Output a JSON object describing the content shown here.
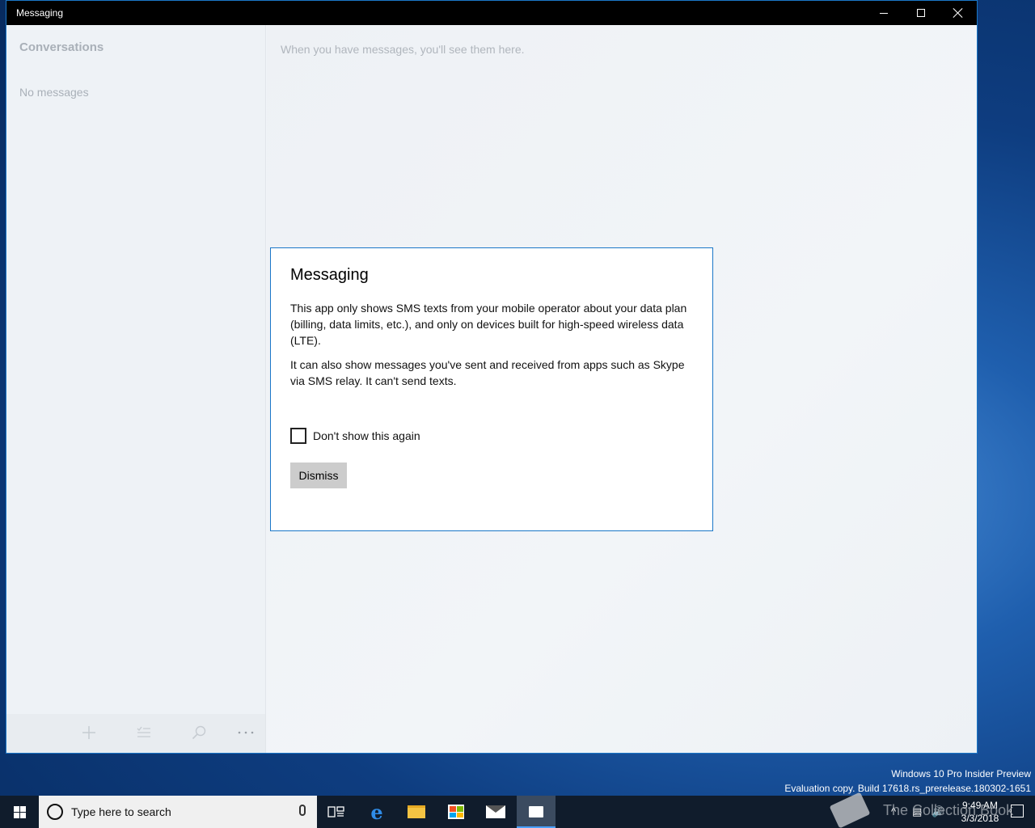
{
  "window": {
    "title": "Messaging",
    "controls": {
      "minimize": "minimize-icon",
      "maximize": "maximize-icon",
      "close": "close-icon"
    }
  },
  "sidebar": {
    "heading": "Conversations",
    "empty_text": "No messages",
    "toolbar": [
      "plus-icon",
      "select-list-icon",
      "search-icon",
      "more-icon"
    ]
  },
  "main": {
    "hint": "When you have messages, you'll see them here."
  },
  "dialog": {
    "title": "Messaging",
    "paragraph1": "This app only shows SMS texts from your mobile operator about your data plan (billing, data limits, etc.), and only on devices built for high-speed wireless data (LTE).",
    "paragraph2": "It can also show messages you've sent and received from apps such as Skype via SMS relay. It can't send texts.",
    "checkbox_label": "Don't show this again",
    "checkbox_checked": false,
    "dismiss_label": "Dismiss"
  },
  "desktop": {
    "watermark_line1": "Windows 10 Pro Insider Preview",
    "watermark_line2": "Evaluation copy. Build 17618.rs_prerelease.180302-1651",
    "overlay_text": "The Collection Book"
  },
  "taskbar": {
    "search_placeholder": "Type here to search",
    "apps": [
      "task-view-icon",
      "edge-icon",
      "file-explorer-icon",
      "store-icon",
      "mail-icon",
      "messaging-icon"
    ],
    "clock_time": "9:49 AM",
    "clock_date": "3/3/2018"
  },
  "colors": {
    "accent": "#1b77c8",
    "titlebar": "#000000",
    "taskbar": "#101c2c",
    "dismiss_button": "#cccccc"
  }
}
